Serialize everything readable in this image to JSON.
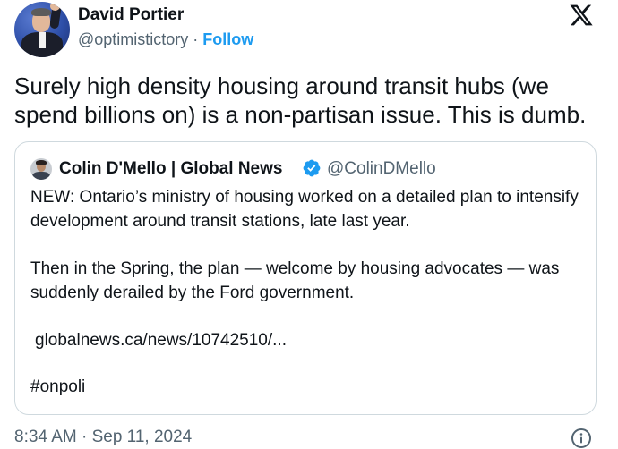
{
  "author": {
    "display_name": "David Portier",
    "handle": "@optimistictory",
    "separator": "·",
    "follow_label": "Follow"
  },
  "tweet": {
    "text": "Surely high density housing around transit hubs (we spend billions on) is a non-partisan issue. This is dumb.",
    "timestamp": "8:34 AM · Sep 11, 2024"
  },
  "quoted_tweet": {
    "display_name": "Colin D'Mello | Global News",
    "handle": "@ColinDMello",
    "paragraph_1": "NEW: Ontario’s ministry of housing worked on a detailed plan to intensify development around transit stations, late last year.",
    "paragraph_2": "Then in the Spring, the plan — welcome by housing advocates — was suddenly derailed by the Ford government.",
    "link": "globalnews.ca/news/10742510/...",
    "hashtag": "#onpoli"
  },
  "icons": {
    "logo": "x-logo-icon",
    "verified": "verified-badge-icon",
    "info": "info-icon"
  },
  "colors": {
    "accent": "#1d9bf0",
    "secondary_text": "#536471",
    "border": "#cfd9de"
  }
}
